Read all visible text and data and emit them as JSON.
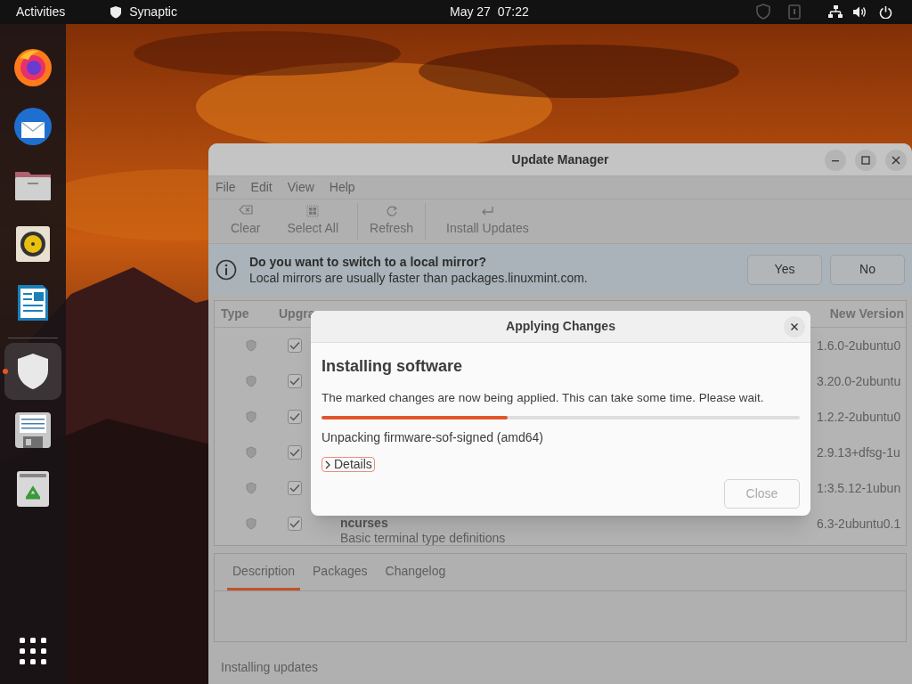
{
  "top_bar": {
    "activities": "Activities",
    "app_name": "Synaptic",
    "clock": "May 27  07:22"
  },
  "dock": {
    "items": [
      {
        "kind": "firefox",
        "running": false
      },
      {
        "kind": "mail",
        "running": false
      },
      {
        "kind": "folder",
        "running": false
      },
      {
        "kind": "speaker",
        "running": false
      },
      {
        "kind": "writer",
        "running": false
      },
      {
        "kind": "separator"
      },
      {
        "kind": "shield",
        "running": true
      },
      {
        "kind": "floppy",
        "running": false
      },
      {
        "kind": "trash",
        "running": false
      }
    ]
  },
  "window": {
    "title": "Update Manager",
    "menu": [
      "File",
      "Edit",
      "View",
      "Help"
    ],
    "toolbar": [
      "Clear",
      "Select All",
      "Refresh",
      "Install Updates"
    ],
    "infobar": {
      "title": "Do you want to switch to a local mirror?",
      "text": "Local mirrors are usually faster than packages.linuxmint.com.",
      "buttons": [
        "Yes",
        "No"
      ]
    },
    "table": {
      "columns": [
        "Type",
        "Upgra",
        "New Version"
      ],
      "rows": [
        {
          "checked": true,
          "new_version": "1.6.0-2ubuntu0"
        },
        {
          "checked": true,
          "new_version": "3.20.0-2ubuntu"
        },
        {
          "checked": true,
          "new_version": "1.2.2-2ubuntu0"
        },
        {
          "checked": true,
          "new_version": "2.9.13+dfsg-1u"
        },
        {
          "checked": true,
          "new_version": "1:3.5.12-1ubun"
        },
        {
          "checked": true,
          "name": "ncurses",
          "description": "Basic terminal type definitions",
          "new_version": "6.3-2ubuntu0.1"
        }
      ]
    },
    "tabs": [
      {
        "label": "Description",
        "selected": true
      },
      {
        "label": "Packages",
        "selected": false
      },
      {
        "label": "Changelog",
        "selected": false
      }
    ],
    "status_bar": "Installing updates"
  },
  "dialog": {
    "title": "Applying Changes",
    "heading": "Installing software",
    "message": "The marked changes are now being applied. This can take some time. Please wait.",
    "level": 0.39,
    "progress_text": "Unpacking firmware-sof-signed (amd64)",
    "details": "Details",
    "close": "Close"
  }
}
